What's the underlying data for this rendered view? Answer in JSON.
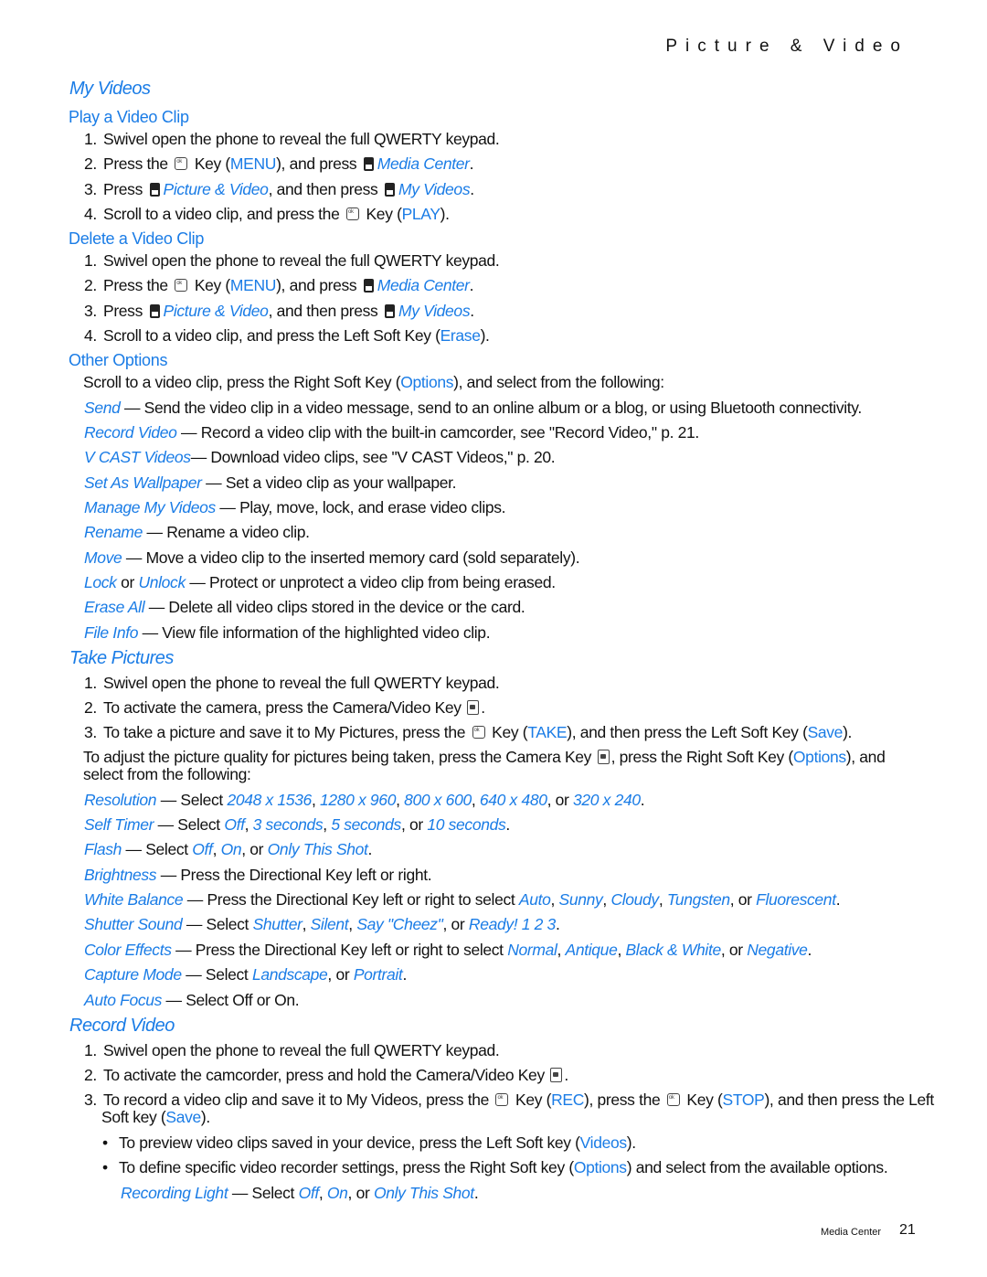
{
  "header": {
    "section": "Picture & Video"
  },
  "my_videos": {
    "title": "My Videos",
    "play": {
      "title": "Play a Video Clip",
      "steps": [
        {
          "n": "1.",
          "text": "Swivel open the phone to reveal the full QWERTY keypad."
        },
        {
          "n": "2.",
          "a": "Press the",
          "b": "Key (",
          "c": "MENU",
          "d": "), and press",
          "e": "Media Center",
          "f": "."
        },
        {
          "n": "3.",
          "a": "Press",
          "b": "Picture & Video",
          "c": ", and then press",
          "d": "My Videos",
          "e": "."
        },
        {
          "n": "4.",
          "a": "Scroll to a video clip, and press the",
          "b": "Key (",
          "c": "PLAY",
          "d": ")."
        }
      ]
    },
    "delete": {
      "title": "Delete a Video Clip",
      "steps": [
        {
          "n": "1.",
          "text": "Swivel open the phone to reveal the full QWERTY keypad."
        },
        {
          "n": "2.",
          "a": "Press the",
          "b": "Key (",
          "c": "MENU",
          "d": "), and press",
          "e": "Media Center",
          "f": "."
        },
        {
          "n": "3.",
          "a": "Press",
          "b": "Picture & Video",
          "c": ", and then press",
          "d": "My Videos",
          "e": "."
        },
        {
          "n": "4.",
          "a": "Scroll to a video clip, and press the Left Soft Key (",
          "b": "Erase",
          "c": ")."
        }
      ]
    },
    "other": {
      "title": "Other Options",
      "intro_a": "Scroll to a video clip, press the Right Soft Key (",
      "intro_b": "Options",
      "intro_c": "), and select from the following:",
      "items": [
        {
          "term": "Send",
          "desc": " — Send the video clip in a video message, send to an online album or a blog, or using Bluetooth connectivity."
        },
        {
          "term": "Record Video",
          "desc": " — Record a video clip with the built-in camcorder, see \"Record Video,\" p. 21."
        },
        {
          "term": "V CAST Videos",
          "desc": "— Download video clips, see \"V CAST Videos,\" p. 20."
        },
        {
          "term": "Set As Wallpaper",
          "desc": " — Set a video clip as your wallpaper."
        },
        {
          "term": "Manage My Videos",
          "desc": " — Play, move, lock, and erase video clips."
        },
        {
          "term": "Rename",
          "desc": " — Rename a video clip."
        },
        {
          "term": "Move",
          "desc": " — Move a video clip to the inserted memory card (sold separately)."
        },
        {
          "term": "Lock",
          "or": " or ",
          "term2": "Unlock",
          "desc": " — Protect or unprotect a video clip from being erased."
        },
        {
          "term": "Erase All",
          "desc": " — Delete all video clips stored in the device or the card."
        },
        {
          "term": "File Info",
          "desc": " — View file information of the highlighted video clip."
        }
      ]
    }
  },
  "take_pictures": {
    "title": "Take Pictures",
    "steps": [
      {
        "n": "1.",
        "text": "Swivel open the phone to reveal the full QWERTY keypad."
      },
      {
        "n": "2.",
        "a": "To activate the camera, press the Camera/Video Key",
        "b": "."
      },
      {
        "n": "3.",
        "a": "To take a picture and save it to My Pictures, press the",
        "b": "Key (",
        "c": "TAKE",
        "d": "), and then press the Left Soft Key (",
        "e": "Save",
        "f": ")."
      }
    ],
    "adjust_a": "To adjust the picture quality for pictures being taken, press the Camera Key",
    "adjust_b": ", press the Right Soft Key (",
    "adjust_c": "Options",
    "adjust_d": "), and",
    "adjust_e": "select from the following:",
    "options": [
      {
        "term": "Resolution",
        "pre": " — Select ",
        "vals": [
          "2048 x 1536",
          "1280 x 960",
          "800 x 600",
          "640 x 480",
          "320 x 240"
        ]
      },
      {
        "term": "Self Timer",
        "pre": " — Select ",
        "vals": [
          "Off",
          "3 seconds",
          "5 seconds",
          "10 seconds"
        ]
      },
      {
        "term": "Flash",
        "pre": " — Select ",
        "vals": [
          "Off",
          "On",
          "Only This Shot"
        ]
      },
      {
        "term": "Brightness",
        "desc": " — Press the Directional Key left or right."
      },
      {
        "term": "White Balance",
        "pre": " — Press the Directional Key left or right to select ",
        "vals": [
          "Auto",
          "Sunny",
          "Cloudy",
          "Tungsten",
          "Fluorescent"
        ]
      },
      {
        "term": "Shutter Sound",
        "pre": " — Select ",
        "vals": [
          "Shutter",
          "Silent",
          "Say \"Cheez\"",
          "Ready! 1 2 3"
        ]
      },
      {
        "term": "Color Effects",
        "pre": " — Press the Directional Key left or right to select ",
        "vals": [
          "Normal",
          "Antique",
          "Black & White",
          "Negative"
        ]
      },
      {
        "term": "Capture Mode",
        "pre": " — Select ",
        "vals": [
          "Landscape",
          "Portrait"
        ]
      },
      {
        "term": "Auto Focus",
        "desc": " — Select Off or On."
      }
    ]
  },
  "record_video": {
    "title": "Record Video",
    "steps": [
      {
        "n": "1.",
        "text": "Swivel open the phone to reveal the full QWERTY keypad."
      },
      {
        "n": "2.",
        "a": "To activate the camcorder, press and hold the Camera/Video Key",
        "b": "."
      },
      {
        "n": "3.",
        "a": "To record a video clip and save it to My Videos, press the",
        "b": "Key (",
        "c": "REC",
        "d": "), press the",
        "e": "Key (",
        "f": "STOP",
        "g": "), and then press the Left",
        "h": "Soft key (",
        "i": "Save",
        "j": ")."
      }
    ],
    "bullets": [
      {
        "a": "To preview video clips saved in your device, press the Left Soft key (",
        "b": "Videos",
        "c": ")."
      },
      {
        "a": "To define specific video recorder settings, press the Right Soft key (",
        "b": "Options",
        "c": ") and select from the available options."
      }
    ],
    "sub": {
      "term": "Recording Light",
      "pre": " — Select ",
      "vals": [
        "Off",
        "On",
        "Only This Shot"
      ]
    }
  },
  "footer": {
    "label": "Media Center",
    "page": "21"
  }
}
